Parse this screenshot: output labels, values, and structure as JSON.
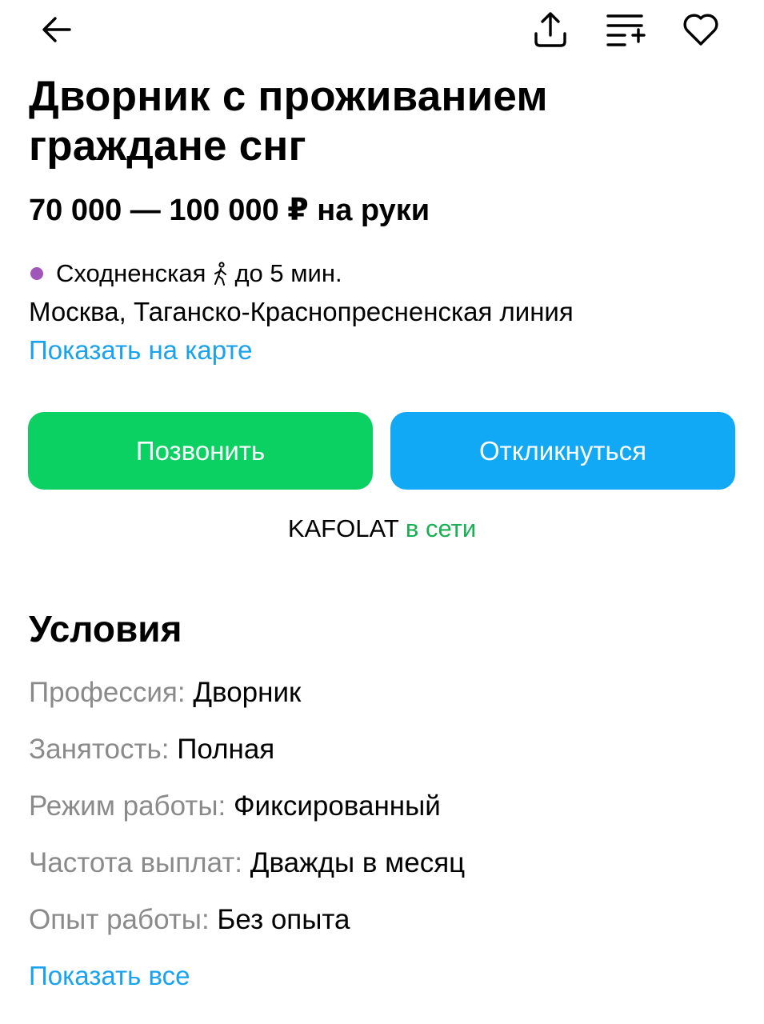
{
  "header": {
    "back_icon": "arrow-left-icon",
    "share_icon": "share-upload-icon",
    "compare_icon": "list-add-icon",
    "favorite_icon": "heart-outline-icon"
  },
  "vacancy": {
    "title": "Дворник с проживанием граждане снг",
    "salary": "70 000 — 100 000 ₽ на руки"
  },
  "location": {
    "metro_station": "Сходненская",
    "metro_color": "#a155b9",
    "walk_icon": "walking-person-icon",
    "metro_time": "до 5 мин.",
    "address": "Москва, Таганско-Краснопресненская линия",
    "map_link": "Показать на карте"
  },
  "actions": {
    "call_label": "Позвонить",
    "call_color": "#0bd062",
    "respond_label": "Откликнуться",
    "respond_color": "#11a9f5"
  },
  "employer": {
    "name": "KAFOLAT",
    "status": "в сети"
  },
  "conditions": {
    "title": "Условия",
    "items": [
      {
        "key": "Профессия:",
        "value": "Дворник"
      },
      {
        "key": "Занятость:",
        "value": "Полная"
      },
      {
        "key": "Режим работы:",
        "value": "Фиксированный"
      },
      {
        "key": "Частота выплат:",
        "value": "Дважды в месяц"
      },
      {
        "key": "Опыт работы:",
        "value": "Без опыта"
      }
    ],
    "show_all": "Показать все"
  }
}
